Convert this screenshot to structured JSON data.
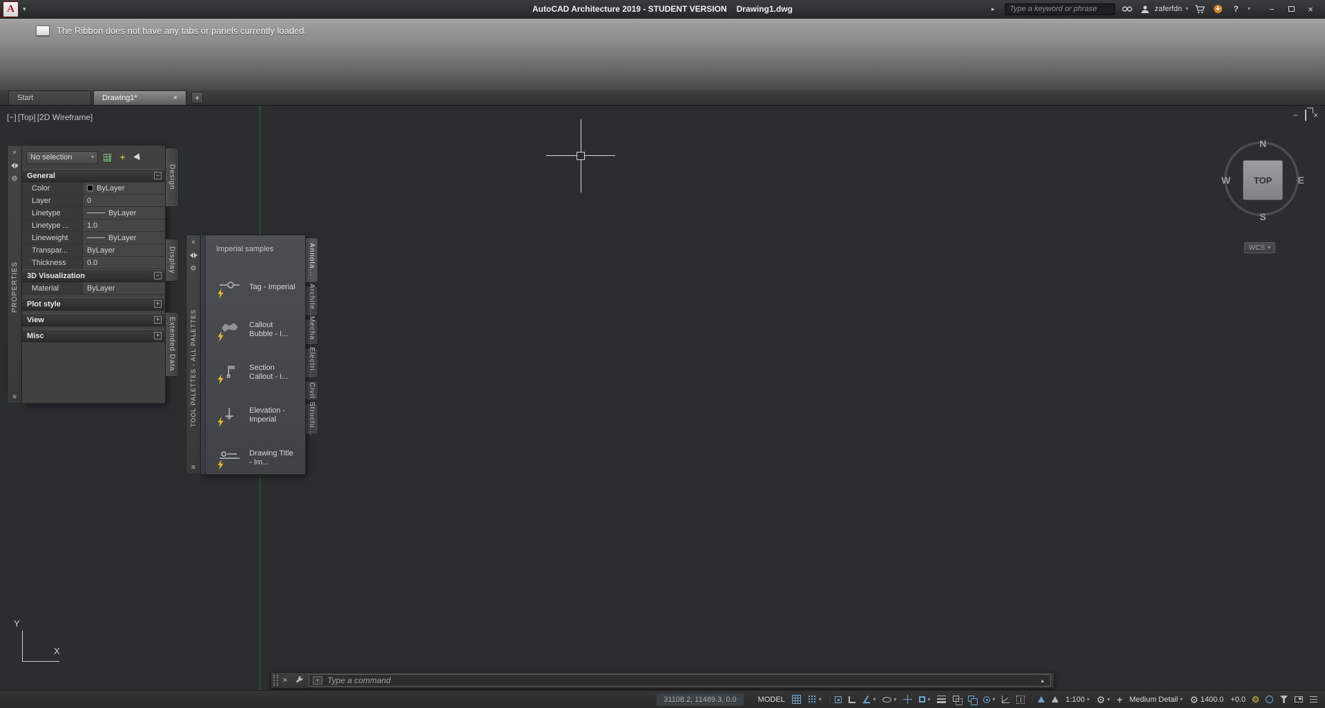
{
  "glyphs": {
    "close": "×",
    "chevron_down": "▾",
    "chevron_up": "▴",
    "chevron_right": "▸",
    "plus": "+",
    "minus": "−",
    "gear": "⚙",
    "angle": "∠",
    "question": "?",
    "logo_letter": "A",
    "list": "≡"
  },
  "titlebar": {
    "product": "AutoCAD Architecture 2019 - STUDENT VERSION",
    "filename": "Drawing1.dwg",
    "search_placeholder": "Type a keyword or phrase",
    "username": "zaferfdn"
  },
  "ribbon": {
    "message": "The Ribbon does not have any tabs or panels currently loaded."
  },
  "file_tabs": {
    "start": "Start",
    "drawing": "Drawing1*"
  },
  "viewport": {
    "minimize": "[−]",
    "view": "[Top]",
    "visual_style": "[2D Wireframe]"
  },
  "viewcube": {
    "north": "N",
    "south": "S",
    "east": "E",
    "west": "W",
    "top": "TOP",
    "wcs": "WCS"
  },
  "ucs": {
    "x": "X",
    "y": "Y"
  },
  "properties": {
    "title": "PROPERTIES",
    "selection": "No selection",
    "general": {
      "title": "General",
      "rows": [
        {
          "label": "Color",
          "value": "ByLayer"
        },
        {
          "label": "Layer",
          "value": "0"
        },
        {
          "label": "Linetype",
          "value": "ByLayer"
        },
        {
          "label": "Linetype ...",
          "value": "1.0"
        },
        {
          "label": "Lineweight",
          "value": "ByLayer"
        },
        {
          "label": "Transpar...",
          "value": "ByLayer"
        },
        {
          "label": "Thickness",
          "value": "0.0"
        }
      ]
    },
    "visualization": {
      "title": "3D Visualization",
      "rows": [
        {
          "label": "Material",
          "value": "ByLayer"
        }
      ]
    },
    "collapsed_sections": [
      {
        "title": "Plot style"
      },
      {
        "title": "View"
      },
      {
        "title": "Misc"
      }
    ],
    "tabs": [
      {
        "label": "Design"
      },
      {
        "label": "Display"
      },
      {
        "label": "Extended Data"
      }
    ]
  },
  "tool_palettes": {
    "title": "TOOL PALETTES - ALL PALETTES",
    "group": "Imperial samples",
    "items": [
      {
        "label": "Tag - Imperial"
      },
      {
        "label": "Callout Bubble - I..."
      },
      {
        "label": "Section Callout - I..."
      },
      {
        "label": "Elevation - Imperial"
      },
      {
        "label": "Drawing Title - Im..."
      }
    ],
    "tabs": [
      {
        "label": "Annota..."
      },
      {
        "label": "Archite..."
      },
      {
        "label": "Mecha..."
      },
      {
        "label": "Electri..."
      },
      {
        "label": "Civil"
      },
      {
        "label": "Structu..."
      }
    ]
  },
  "command_line": {
    "prompt": "Type a command"
  },
  "status_bar": {
    "coordinates": "31108.2, 11489.3, 0.0",
    "model": "MODEL",
    "scale": "1:100",
    "detail_level": "Medium Detail",
    "cut_plane": "1400.0",
    "elevation": "+0.0"
  },
  "colors": {
    "accent_blue": "#6ea7d8",
    "bolt_yellow": "#f2b32a",
    "drawing_background": "#2a2e30",
    "construction_line_green": "#1e6d22"
  }
}
